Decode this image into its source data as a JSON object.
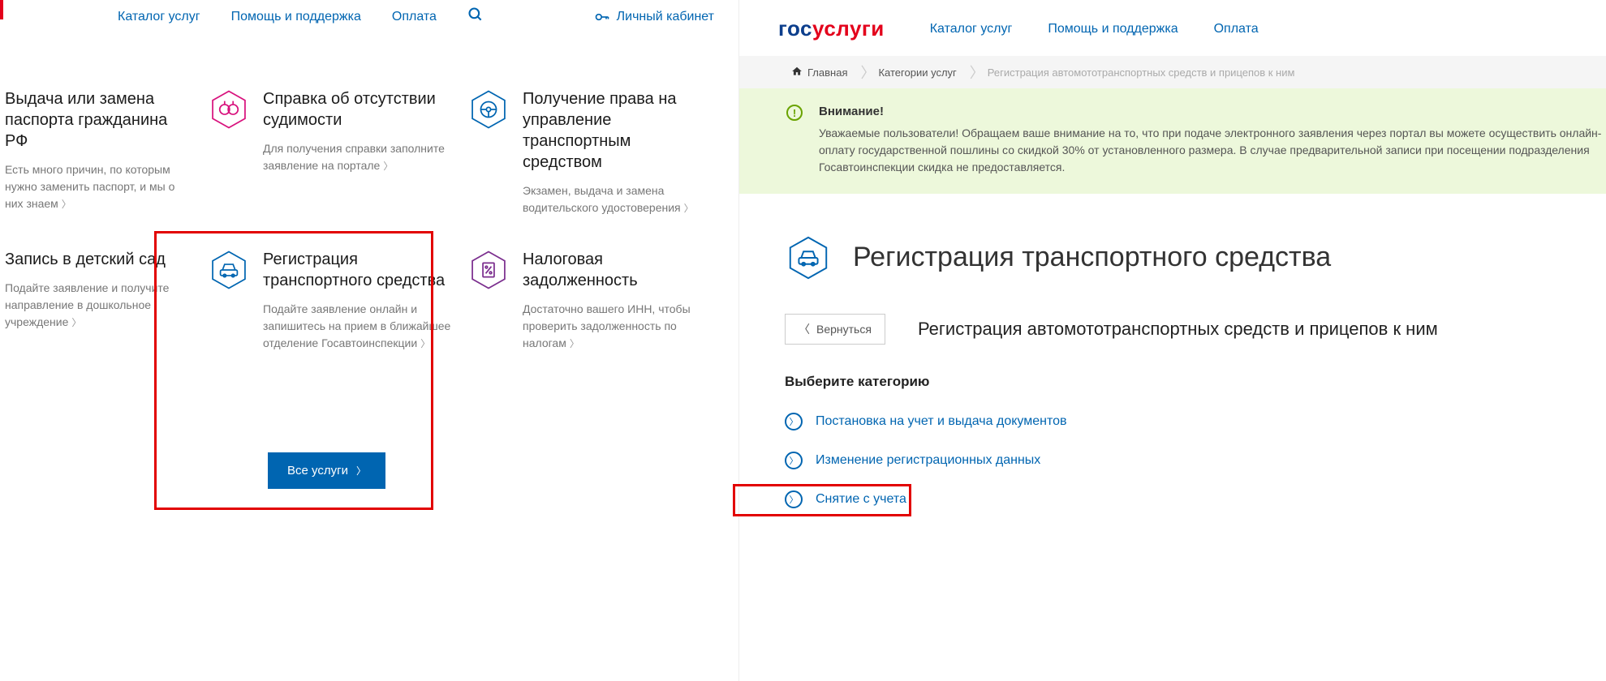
{
  "nav": {
    "catalog": "Каталог услуг",
    "help": "Помощь и поддержка",
    "payment": "Оплата",
    "account": "Личный кабинет"
  },
  "logo": {
    "part1": "гос",
    "part2": "услуги"
  },
  "left": {
    "cards": {
      "passport": {
        "title": "Выдача или замена паспорта гражданина РФ",
        "desc": "Есть много причин, по которым нужно заменить паспорт, и мы о них знаем"
      },
      "criminal": {
        "title": "Справка об отсутствии судимости",
        "desc": "Для получения справки заполните заявление на портале"
      },
      "driving": {
        "title": "Получение права на управление транспортным средством",
        "desc": "Экзамен, выдача и замена водительского удостоверения"
      },
      "kindergarten": {
        "title": "Запись в детский сад",
        "desc": "Подайте заявление и получите направление в дошкольное учреждение"
      },
      "vehicle": {
        "title": "Регистрация транспортного средства",
        "desc": "Подайте заявление онлайн и запишитесь на прием в ближайшее отделение Госавтоинспекции"
      },
      "tax": {
        "title": "Налоговая задолженность",
        "desc": "Достаточно вашего ИНН, чтобы проверить задолженность по налогам"
      }
    },
    "all_services": "Все услуги"
  },
  "right": {
    "breadcrumb": {
      "home": "Главная",
      "categories": "Категории услуг",
      "current": "Регистрация автомототранспортных средств и прицепов к ним"
    },
    "alert": {
      "title": "Внимание!",
      "text": "Уважаемые пользователи! Обращаем ваше внимание на то, что при подаче электронного заявления через портал вы можете осуществить онлайн-оплату государственной пошлины со скидкой 30% от установленного размера. В случае предварительной записи при посещении подразделения Госавтоинспекции скидка не предоставляется."
    },
    "page_title": "Регистрация транспортного средства",
    "back": "Вернуться",
    "subtitle": "Регистрация автомототранспортных средств и прицепов к ним",
    "choose_category": "Выберите категорию",
    "categories": [
      "Постановка на учет и выдача документов",
      "Изменение регистрационных данных",
      "Снятие с учета"
    ]
  }
}
